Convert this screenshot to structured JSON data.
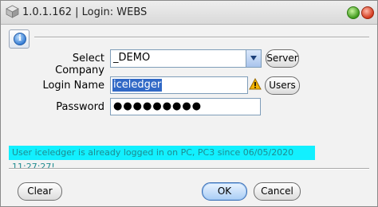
{
  "window": {
    "title": "1.0.1.162 | Login: WEBS",
    "icon": "app-cube-icon"
  },
  "form": {
    "company_label": "Select Company",
    "company_value": "_DEMO",
    "server_button": "Server",
    "login_label": "Login Name",
    "login_value": "iceledger",
    "users_button": "Users",
    "password_label": "Password",
    "password_mask": "●●●●●●●●●"
  },
  "status": {
    "message": "User iceledger is already logged in on PC, PC3 since 06/05/2020 11:27:27!",
    "background": "#12f0ff"
  },
  "buttons": {
    "clear": "Clear",
    "ok": "OK",
    "cancel": "Cancel"
  },
  "icons": {
    "info": "info-icon",
    "warning": "warning-icon",
    "dropdown": "chevron-down-icon"
  },
  "colors": {
    "selection": "#3169c6",
    "status_text": "#1f8a8f"
  }
}
